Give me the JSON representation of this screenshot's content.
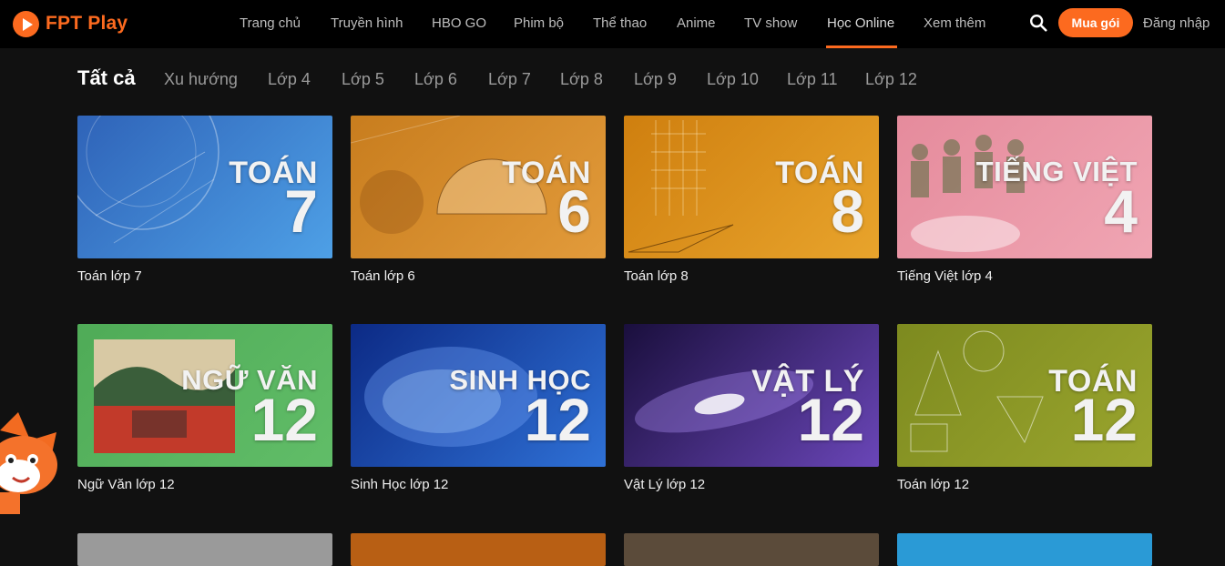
{
  "brand": {
    "name": "FPT Play"
  },
  "nav": {
    "items": [
      "Trang chủ",
      "Truyền hình",
      "HBO GO",
      "Phim bộ",
      "Thể thao",
      "Anime",
      "TV show",
      "Học Online",
      "Xem thêm"
    ],
    "active": "Học Online",
    "buy_label": "Mua gói",
    "login_label": "Đăng nhập"
  },
  "filters": {
    "tabs": [
      "Tất cả",
      "Xu hướng",
      "Lớp 4",
      "Lớp 5",
      "Lớp 6",
      "Lớp 7",
      "Lớp 8",
      "Lớp 9",
      "Lớp 10",
      "Lớp 11",
      "Lớp 12"
    ],
    "active": "Tất cả"
  },
  "courses": [
    {
      "title": "Toán lớp 7",
      "thumb_word": "TOÁN",
      "thumb_number": "7",
      "bg": [
        "#2f63b8",
        "#4ea0e6"
      ]
    },
    {
      "title": "Toán lớp 6",
      "thumb_word": "TOÁN",
      "thumb_number": "6",
      "bg": [
        "#c87d1e",
        "#e29b3b"
      ]
    },
    {
      "title": "Toán lớp 8",
      "thumb_word": "TOÁN",
      "thumb_number": "8",
      "bg": [
        "#cf7f0f",
        "#e8a42c"
      ]
    },
    {
      "title": "Tiếng Việt lớp 4",
      "thumb_word": "TIẾNG VIỆT",
      "thumb_number": "4",
      "bg": [
        "#e58b9c",
        "#f0a5b3"
      ]
    },
    {
      "title": "Ngữ Văn lớp 12",
      "thumb_word": "NGỮ VĂN",
      "thumb_number": "12",
      "bg": [
        "#4fab57",
        "#61bd68"
      ]
    },
    {
      "title": "Sinh Học lớp 12",
      "thumb_word": "SINH HỌC",
      "thumb_number": "12",
      "bg": [
        "#0c2a85",
        "#2f71d6"
      ]
    },
    {
      "title": "Vật Lý lớp 12",
      "thumb_word": "VẬT LÝ",
      "thumb_number": "12",
      "bg": [
        "#1a0f3d",
        "#6a46b8"
      ]
    },
    {
      "title": "Toán lớp 12",
      "thumb_word": "TOÁN",
      "thumb_number": "12",
      "bg": [
        "#7d8a1f",
        "#9aa52e"
      ]
    }
  ],
  "next_row_bg": [
    "#9a9a9a",
    "#b85f14",
    "#5b4b3a",
    "#2a9ad6"
  ],
  "colors": {
    "accent": "#fc6a1f",
    "background": "#111111",
    "header": "#000000"
  },
  "icons": [
    "play-logo-icon",
    "search-icon",
    "mascot-icon"
  ]
}
